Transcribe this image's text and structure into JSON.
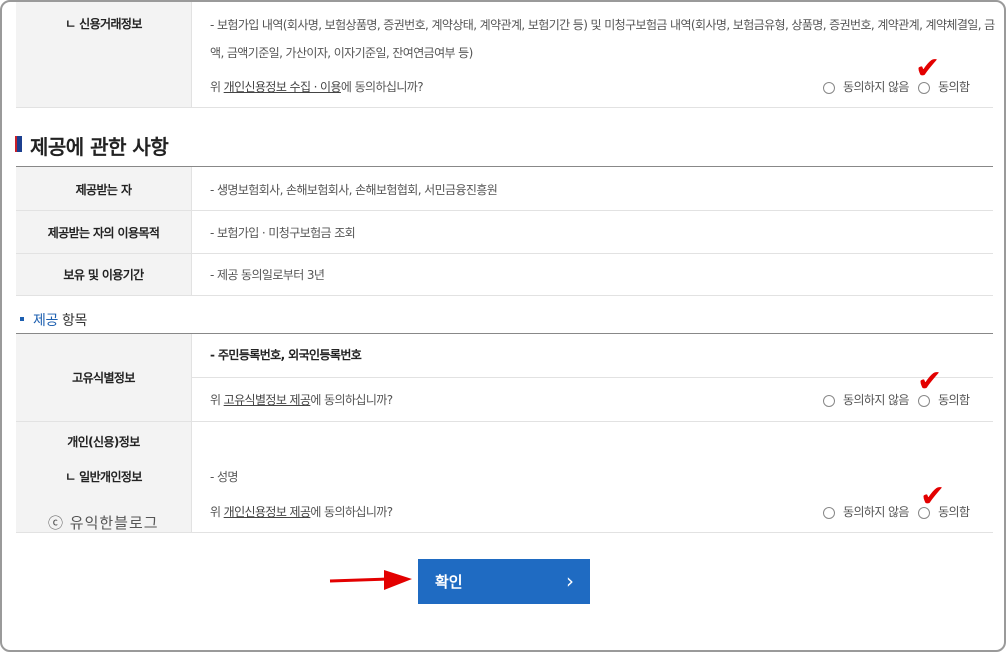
{
  "credit_trade": {
    "label": "ㄴ 신용거래정보",
    "desc_line1": "- 보험가입 내역(회사명, 보험상품명, 증권번호, 계약상태, 계약관계, 보험기간 등) 및 미청구보험금 내역(회사명, 보험금유형, 상품명, 증권번호, 계약관계, 계약체결일, 금",
    "desc_line2": "액, 금액기준일, 가산이자, 이자기준일, 잔여연금여부 등)",
    "question_pre": "위 ",
    "question_link": "개인신용정보 수집 · 이용",
    "question_post": "에 동의하십니까?"
  },
  "options": {
    "disagree": "동의하지 않음",
    "agree": "동의함"
  },
  "provision": {
    "title": "제공에 관한 사항",
    "rows": [
      {
        "label": "제공받는 자",
        "value": "- 생명보험회사, 손해보험회사, 손해보험협회, 서민금융진흥원"
      },
      {
        "label": "제공받는 자의 이용목적",
        "value": "- 보험가입 · 미청구보험금 조회"
      },
      {
        "label": "보유 및 이용기간",
        "value": "- 제공 동의일로부터 3년"
      }
    ]
  },
  "items": {
    "title_blue": "제공",
    "title_rest": " 항목",
    "unique": {
      "label": "고유식별정보",
      "value": "- 주민등록번호, 외국인등록번호",
      "question_pre": "위 ",
      "question_link": "고유식별정보 제공",
      "question_post": "에 동의하십니까?"
    },
    "personal": {
      "label": "개인(신용)정보",
      "sub_label": "ㄴ 일반개인정보",
      "value": "- 성명",
      "question_pre": "위 ",
      "question_link": "개인신용정보 제공",
      "question_post": "에 동의하십니까?"
    }
  },
  "watermark": "ⓒ 유익한블로그",
  "confirm_button": {
    "label": "확인",
    "chevron": "›"
  },
  "colors": {
    "accent": "#1f6bc2",
    "check": "#e30000",
    "arrow": "#e30000"
  },
  "annotations": {
    "check_glyph": "✔"
  }
}
